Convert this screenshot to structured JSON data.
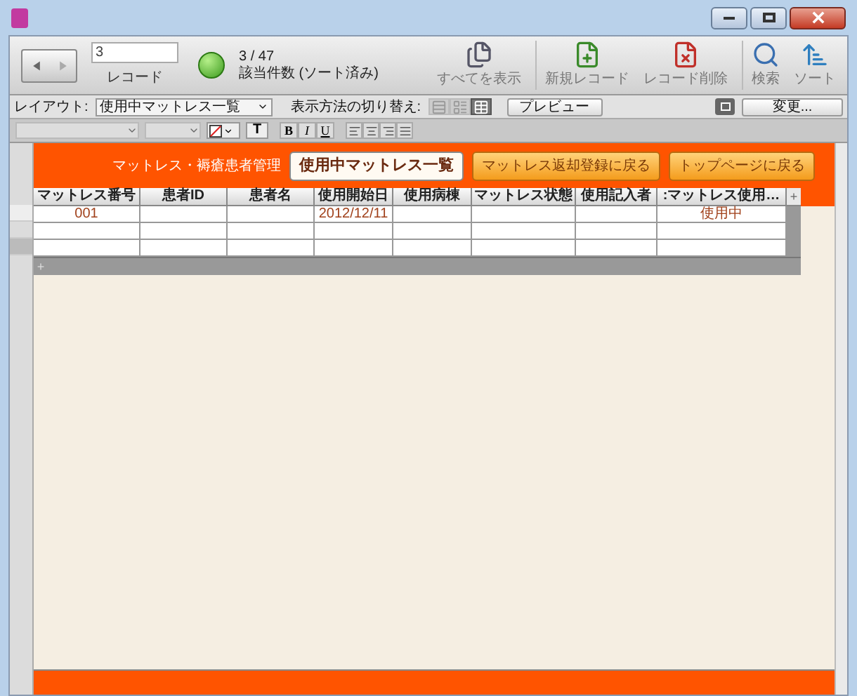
{
  "toolbar": {
    "record_value": "3",
    "record_label": "レコード",
    "count": "3 / 47",
    "count_label": "該当件数 (ソート済み)",
    "buttons": [
      {
        "kind": "show_all",
        "label": "すべてを表示"
      },
      {
        "kind": "new",
        "label": "新規レコード"
      },
      {
        "kind": "delete",
        "label": "レコード削除"
      },
      {
        "kind": "find",
        "label": "検索"
      },
      {
        "kind": "sort",
        "label": "ソート"
      }
    ]
  },
  "layout_bar": {
    "layout_label": "レイアウト:",
    "layout_value": "使用中マットレス一覧",
    "view_label": "表示方法の切り替え:",
    "views": [
      {
        "kind": "form",
        "selected": false
      },
      {
        "kind": "list",
        "selected": false
      },
      {
        "kind": "table",
        "selected": true
      }
    ],
    "preview": "プレビュー",
    "change": "変更..."
  },
  "format_bar": {
    "text_button": "T",
    "styles": [
      "B",
      "I",
      "U"
    ]
  },
  "header": {
    "title": "マットレス・褥瘡患者管理",
    "nav": [
      {
        "label": "使用中マットレス一覧",
        "selected": true
      },
      {
        "label": "マットレス返却登録に戻る",
        "selected": false
      },
      {
        "label": "トップページに戻る",
        "selected": false
      }
    ]
  },
  "table": {
    "columns": [
      "マットレス番号",
      "患者ID",
      "患者名",
      "使用開始日",
      "使用病棟",
      "マットレス状態",
      "使用記入者",
      ":マットレス使用…"
    ],
    "add_column": "+",
    "add_row": "+",
    "rows": [
      {
        "cells": [
          "001",
          null,
          null,
          "2012/12/11",
          null,
          null,
          null,
          "使用中"
        ]
      },
      {
        "cells": [
          null,
          null,
          null,
          null,
          null,
          null,
          null,
          null
        ]
      },
      {
        "cells": [
          null,
          null,
          null,
          null,
          null,
          null,
          null,
          null
        ]
      }
    ]
  }
}
